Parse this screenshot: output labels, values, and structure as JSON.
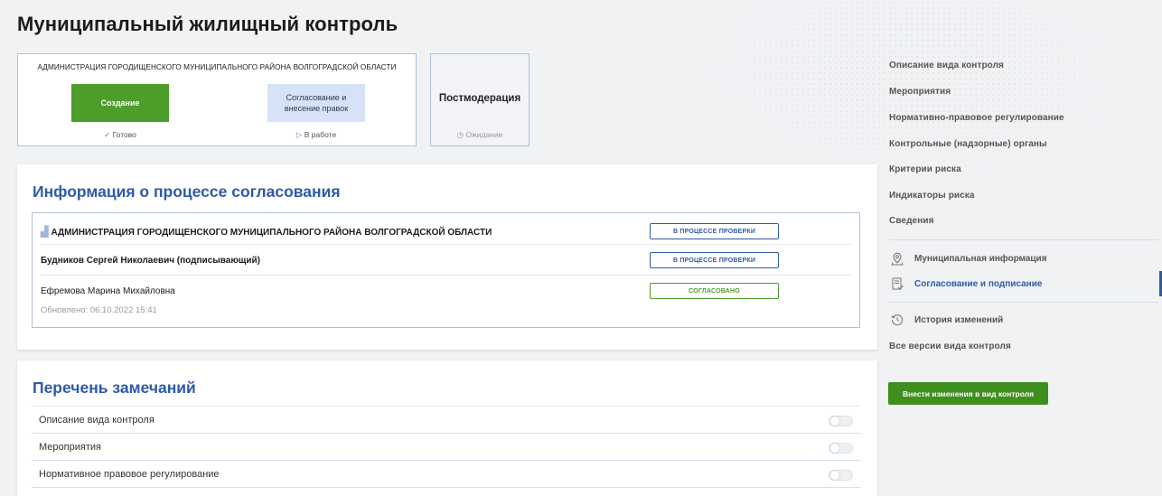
{
  "page_title": "Муниципальный жилищный контроль",
  "stages": {
    "org": "АДМИНИСТРАЦИЯ ГОРОДИЩЕНСКОГО МУНИЦИПАЛЬНОГО РАЙОНА ВОЛГОГРАДСКОЙ ОБЛАСТИ",
    "create": {
      "label": "Создание",
      "status": "Готово",
      "status_mark": "✓"
    },
    "approve": {
      "label_line1": "Согласование и",
      "label_line2": "внесение правок",
      "status": "В работе",
      "status_mark": "▷"
    },
    "postmod": {
      "label": "Постмодерация",
      "status": "Ожидание",
      "status_mark": "◷"
    }
  },
  "approval": {
    "title": "Информация о процессе согласования",
    "rows": [
      {
        "name": "АДМИНИСТРАЦИЯ ГОРОДИЩЕНСКОГО МУНИЦИПАЛЬНОГО РАЙОНА ВОЛГОГРАДСКОЙ ОБЛАСТИ",
        "badge": "В ПРОЦЕССЕ ПРОВЕРКИ"
      },
      {
        "name": "Будников Сергей Николаевич (подписывающий)",
        "badge": "В ПРОЦЕССЕ ПРОВЕРКИ"
      },
      {
        "name": "Ефремова Марина Михайловна",
        "badge": "СОГЛАСОВАНО",
        "updated": "Обновлено: 06.10.2022 15:41"
      }
    ]
  },
  "remarks": {
    "title": "Перечень замечаний",
    "items": [
      {
        "label": "Описание вида контроля"
      },
      {
        "label": "Мероприятия"
      },
      {
        "label": "Нормативное правовое регулирование"
      },
      {
        "label": ""
      }
    ]
  },
  "sidebar": {
    "items": [
      "Описание вида контроля",
      "Мероприятия",
      "Нормативно-правовое регулирование",
      "Контрольные (надзорные) органы",
      "Критерии риска",
      "Индикаторы риска",
      "Сведения"
    ],
    "municipal_info": "Муниципальная информация",
    "approval_signing": "Согласование и подписание",
    "history": "История изменений",
    "all_versions": "Все версии вида контроля",
    "edit_button": "Внести изменения в вид контроля"
  },
  "colors": {
    "accent_blue": "#2d5aa8",
    "green": "#4d9d2a",
    "stage_blue": "#d6e2f6"
  }
}
